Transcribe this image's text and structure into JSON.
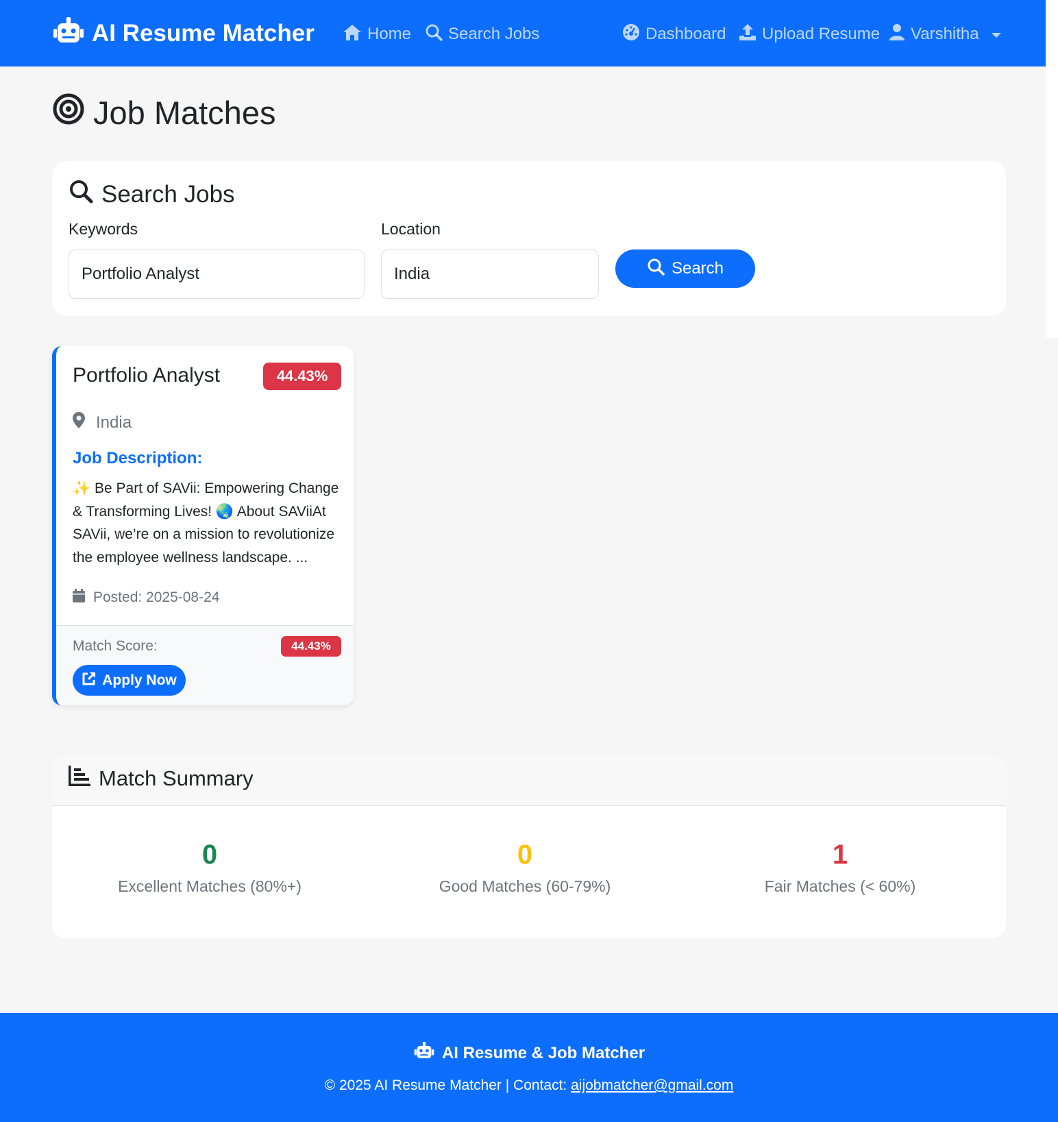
{
  "navbar": {
    "brand": "AI Resume Matcher",
    "links": {
      "home": "Home",
      "search_jobs": "Search Jobs",
      "dashboard": "Dashboard",
      "upload_resume": "Upload Resume",
      "user": "Varshitha"
    }
  },
  "page": {
    "title": "Job Matches"
  },
  "search": {
    "title": "Search Jobs",
    "keywords_label": "Keywords",
    "keywords_value": "Portfolio Analyst",
    "location_label": "Location",
    "location_value": "India",
    "button_label": "Search"
  },
  "jobs": [
    {
      "title": "Portfolio Analyst",
      "score_badge": "44.43%",
      "location": "India",
      "description_label": "Job Description:",
      "description": "✨ Be Part of SAVii: Empowering Change & Transforming Lives! 🌏 About SAViiAt SAVii, we’re on a mission to revolutionize the employee wellness landscape. ...",
      "posted": "Posted: 2025-08-24",
      "match_score_label": "Match Score:",
      "match_score": "44.43%",
      "apply_label": "Apply Now"
    }
  ],
  "summary": {
    "title": "Match Summary",
    "excellent": {
      "count": "0",
      "label": "Excellent Matches (80%+)",
      "color": "#198754"
    },
    "good": {
      "count": "0",
      "label": "Good Matches (60-79%)",
      "color": "#ffc107"
    },
    "fair": {
      "count": "1",
      "label": "Fair Matches (< 60%)",
      "color": "#dc3545"
    }
  },
  "footer": {
    "brand": "AI Resume & Job Matcher",
    "copyright": "© 2025 AI Resume Matcher | Contact:",
    "email": "aijobmatcher@gmail.com"
  },
  "colors": {
    "primary": "#0d6efd",
    "danger": "#dc3545",
    "page_bg": "#f6f6f6"
  }
}
